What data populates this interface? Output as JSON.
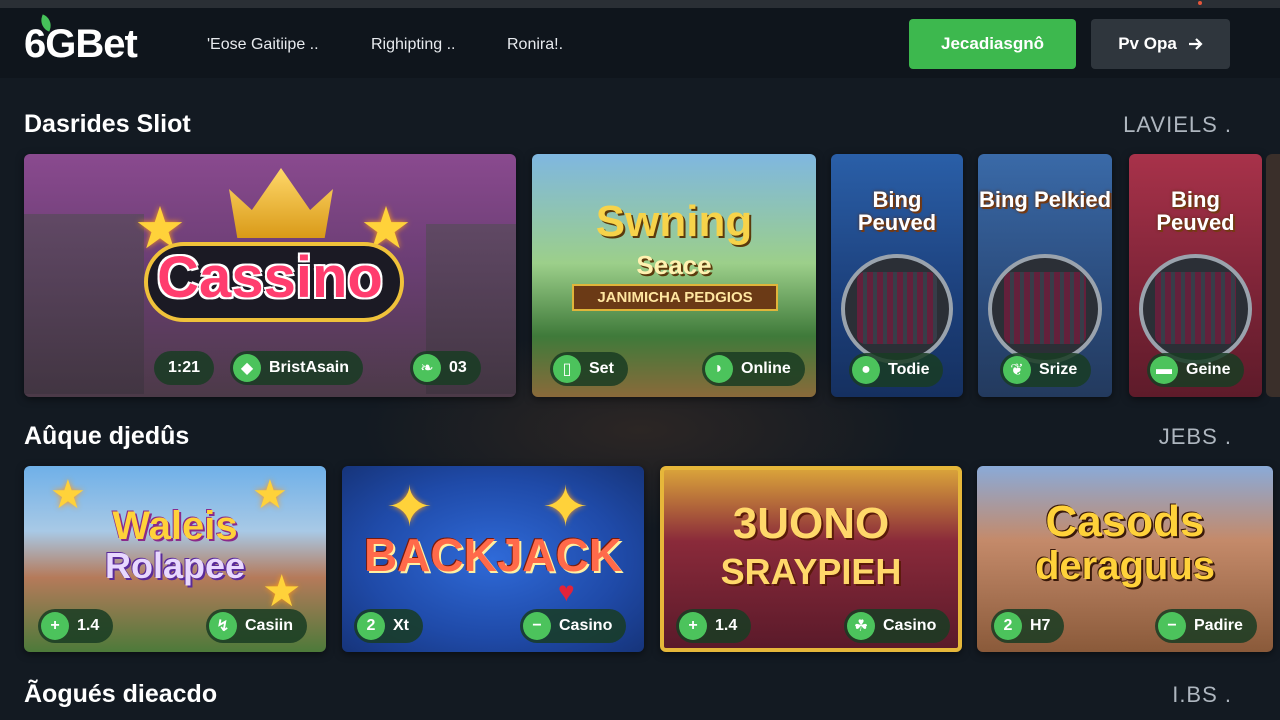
{
  "header": {
    "logo": "6GBet",
    "nav": [
      "'Eose Gaitiipe ..",
      "Righipting ..",
      "Ronira!."
    ],
    "primary_button": "Jecadiasgnô",
    "secondary_button": "Pv Opa"
  },
  "sections": [
    {
      "title": "Dasrides Sliot",
      "more": "LAVIELS ."
    },
    {
      "title": "Aûque djedûs",
      "more": "JEBS ."
    },
    {
      "title": "Ãogués dieacdo",
      "more": "I.BS ."
    }
  ],
  "row1": [
    {
      "art": "Cassino",
      "pills": [
        "1:21",
        "BristAsain",
        "03"
      ]
    },
    {
      "art_line1": "Swning",
      "art_line2": "Seace",
      "art_line3": "JANIMICHA PEDGIOS",
      "pills": [
        "Set",
        "Online"
      ]
    },
    {
      "art": "Bing Peuved",
      "pills": [
        "Todie"
      ]
    },
    {
      "art": "Bing Pelkied",
      "pills": [
        "Srize"
      ]
    },
    {
      "art": "Bing Peuved",
      "pills": [
        "Geine"
      ]
    }
  ],
  "row2": [
    {
      "art_line1": "Waleis",
      "art_line2": "Rolapee",
      "pills": [
        "1.4",
        "Casiin"
      ]
    },
    {
      "art": "BACKJACK",
      "pills": [
        "Xt",
        "Casino"
      ]
    },
    {
      "art_line1": "3UONO",
      "art_line2": "SRAYPIEH",
      "pills": [
        "1.4",
        "Casino"
      ]
    },
    {
      "art_line1": "Casods",
      "art_line2": "deraguus",
      "pills": [
        "H7",
        "Padire"
      ]
    }
  ],
  "icons": {
    "arrow": "arrow-right-icon"
  },
  "colors": {
    "accent": "#3db84e",
    "background": "#131a22",
    "header": "#0f151c"
  }
}
